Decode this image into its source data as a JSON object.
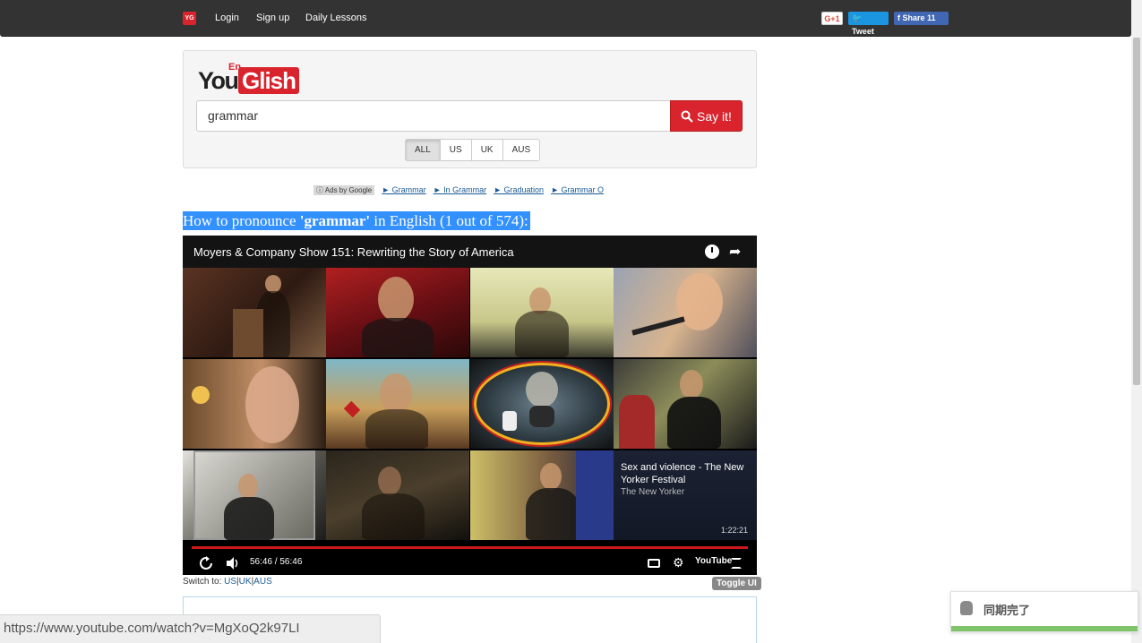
{
  "nav": {
    "badge": "YG",
    "login": "Login",
    "signup": "Sign up",
    "daily_lessons": "Daily Lessons",
    "gplus": "G+1",
    "tweet": "Tweet",
    "share": "Share 11"
  },
  "logo": {
    "you": "You",
    "en": "En",
    "glish": "Glish"
  },
  "search": {
    "value": "grammar",
    "button_label": "Say it!"
  },
  "accents": [
    {
      "label": "ALL",
      "active": true
    },
    {
      "label": "US",
      "active": false
    },
    {
      "label": "UK",
      "active": false
    },
    {
      "label": "AUS",
      "active": false
    }
  ],
  "ads": {
    "badge": "ⓘ Ads by Google",
    "links": [
      "► Grammar",
      "► In Grammar",
      "► Graduation",
      "► Grammar O"
    ]
  },
  "heading": {
    "prefix": "How to pronounce ",
    "word": "'grammar'",
    "suffix": " in English (1 out of 574):"
  },
  "player": {
    "title": "Moyers & Company Show 151: Rewriting the Story of America",
    "suggestion": {
      "title": "Sex and violence - The New Yorker Festival",
      "channel": "The New Yorker",
      "duration": "1:22:21"
    },
    "time": "56:46 / 56:46",
    "youtube_label": "YouTube"
  },
  "switch": {
    "label": "Switch to: ",
    "us": "US",
    "uk": "UK",
    "aus": "AUS",
    "toggle_ui": "Toggle UI"
  },
  "status_url": "https://www.youtube.com/watch?v=MgXoQ2k97LI",
  "sync": {
    "text": "同期完了"
  },
  "colors": {
    "brand_red": "#d9232d",
    "highlight": "#3390ff",
    "progress": "#cc181e",
    "sync_green": "#7fc46a"
  }
}
